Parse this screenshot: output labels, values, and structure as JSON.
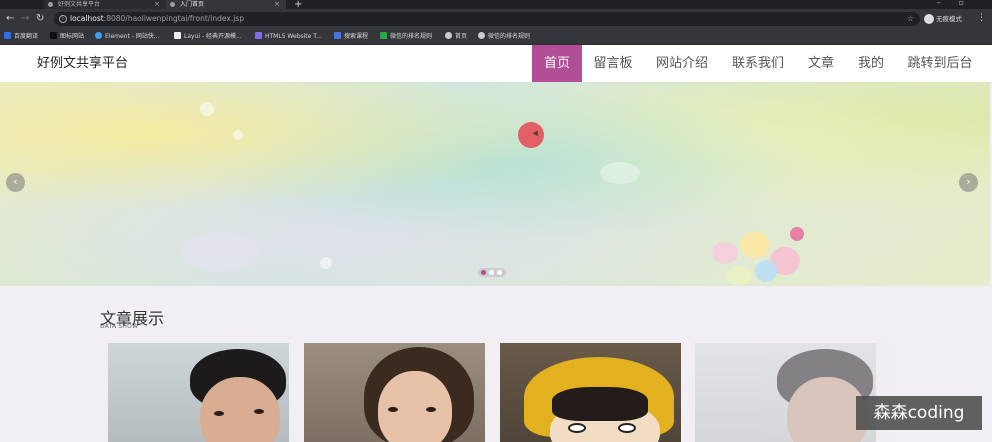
{
  "browser": {
    "tabs": [
      {
        "title": "好例文共享平台"
      },
      {
        "title": "入门首页"
      }
    ],
    "url_host": "localhost",
    "url_path": ":8080/haoliwenpingtai/front/index.jsp",
    "profile_label": "无痕模式",
    "bookmarks": [
      {
        "label": "百度翻译",
        "color": "#2f6fe0"
      },
      {
        "label": "图标网站",
        "color": "#111111"
      },
      {
        "label": "Element - 网站快...",
        "color": "#409eff"
      },
      {
        "label": "Layui - 经典开源模...",
        "color": "#eeeeee"
      },
      {
        "label": "HTML5 Website T...",
        "color": "#7b6cf0"
      },
      {
        "label": "搜索课程",
        "color": "#4a72d8"
      },
      {
        "label": "微信的排名规则",
        "color": "#2aa84a"
      },
      {
        "label": "首页",
        "color": "#cccccc"
      },
      {
        "label": "微信的排名规则",
        "color": "#cccccc"
      }
    ]
  },
  "site": {
    "brand": "好例文共享平台",
    "nav": [
      {
        "label": "首页",
        "active": true
      },
      {
        "label": "留言板",
        "active": false
      },
      {
        "label": "网站介绍",
        "active": false
      },
      {
        "label": "联系我们",
        "active": false
      },
      {
        "label": "文章",
        "active": false
      },
      {
        "label": "我的",
        "active": false
      },
      {
        "label": "跳转到后台",
        "active": false
      }
    ],
    "accent_color": "#b24e96"
  },
  "carousel": {
    "prev_icon": "chevron-left-icon",
    "next_icon": "chevron-right-icon",
    "slide_count": 3,
    "active_index": 0
  },
  "section": {
    "title": "文章展示",
    "subtitle": "DATA SHOW"
  },
  "watermark": "森森coding"
}
